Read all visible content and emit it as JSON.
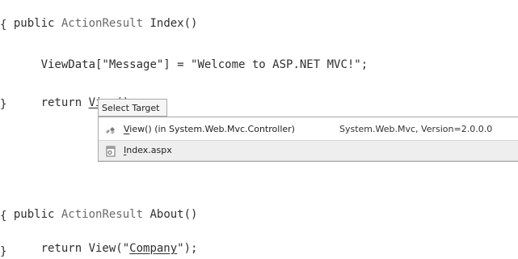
{
  "code": {
    "line1": {
      "keyword": "public ",
      "type": "ActionResult",
      "rest": " Index()"
    },
    "line2": "{",
    "line3": {
      "indent": "    ",
      "text": "ViewData[\"Message\"] = \"Welcome to ASP.NET MVC!\";"
    },
    "line4": {
      "indent": "    ",
      "prefix": "return ",
      "call": "View",
      "suffix": "();"
    },
    "line5": "}",
    "line6": {
      "keyword": "public ",
      "type": "ActionResult",
      "rest": " About()"
    },
    "line7": "{",
    "line8": {
      "indent": "    ",
      "prefix": "return View(\"",
      "arg": "Company",
      "suffix": "\");"
    },
    "line9": "}"
  },
  "popup": {
    "title": "Select Target",
    "items": [
      {
        "icon": "method-icon",
        "label_prefix": "V",
        "label_rest": "iew() (in System.Web.Mvc.Controller)",
        "detail": "System.Web.Mvc, Version=2.0.0.0"
      },
      {
        "icon": "aspx-file-icon",
        "label_prefix": "I",
        "label_rest": "ndex.aspx"
      }
    ]
  }
}
